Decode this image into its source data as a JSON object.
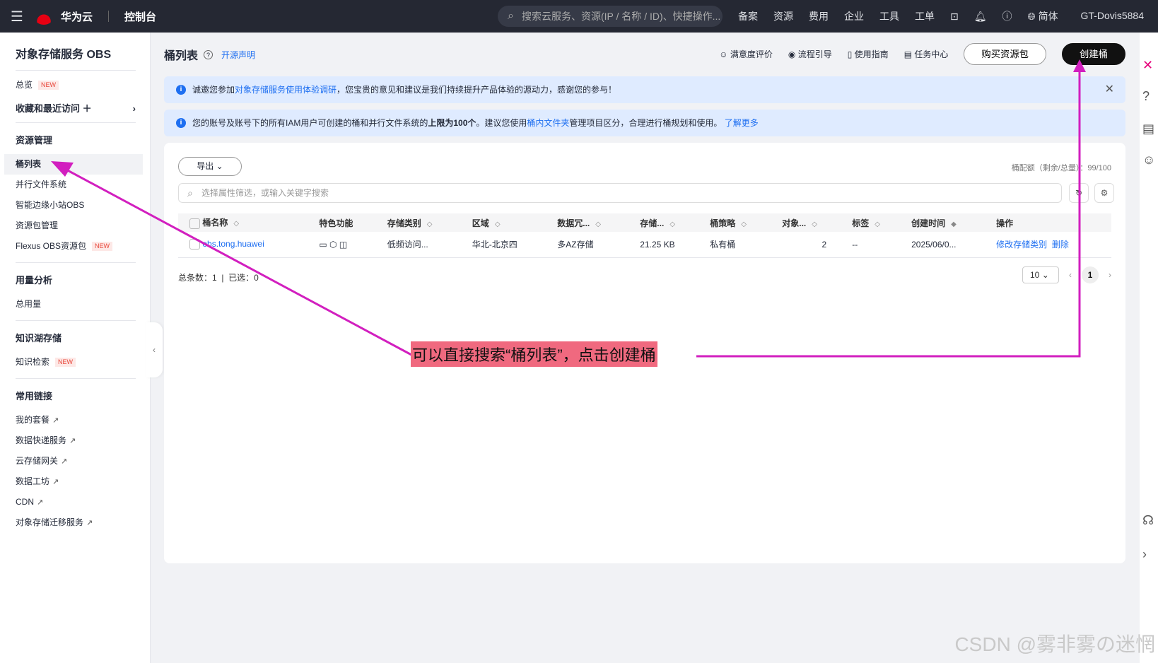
{
  "topbar": {
    "brand": "华为云",
    "brand_sub": "HUAWEI",
    "console": "控制台",
    "search_placeholder": "搜索云服务、资源(IP / 名称 / ID)、快捷操作...",
    "nav": [
      "备案",
      "资源",
      "费用",
      "企业",
      "工具",
      "工单"
    ],
    "lang": "简体",
    "user": "GT-Dovis5884"
  },
  "sidebar": {
    "title": "对象存储服务 OBS",
    "overview": "总览",
    "new": "NEW",
    "favorites": "收藏和最近访问",
    "sections": [
      {
        "title": "资源管理",
        "items": [
          {
            "label": "桶列表",
            "active": true
          },
          {
            "label": "并行文件系统"
          },
          {
            "label": "智能边缘小站OBS"
          },
          {
            "label": "资源包管理"
          },
          {
            "label": "Flexus OBS资源包",
            "new": true
          }
        ]
      },
      {
        "title": "用量分析",
        "items": [
          {
            "label": "总用量"
          }
        ]
      },
      {
        "title": "知识湖存储",
        "items": [
          {
            "label": "知识检索",
            "new": true
          }
        ]
      },
      {
        "title": "常用链接",
        "items": [
          {
            "label": "我的套餐",
            "ext": true
          },
          {
            "label": "数据快递服务",
            "ext": true
          },
          {
            "label": "云存储网关",
            "ext": true
          },
          {
            "label": "数据工坊",
            "ext": true
          },
          {
            "label": "CDN",
            "ext": true
          },
          {
            "label": "对象存储迁移服务",
            "ext": true
          }
        ]
      }
    ]
  },
  "page": {
    "title": "桶列表",
    "open_source": "开源声明",
    "actions": [
      "满意度评价",
      "流程引导",
      "使用指南",
      "任务中心"
    ],
    "buy": "购买资源包",
    "create": "创建桶"
  },
  "banner1": {
    "pre": "诚邀您参加",
    "link": "对象存储服务使用体验调研",
    "post": "，您宝贵的意见和建议是我们持续提升产品体验的源动力，感谢您的参与！"
  },
  "banner2": {
    "pre": "您的账号及账号下的所有IAM用户可创建的桶和并行文件系统的",
    "bold": "上限为100个",
    "mid": "。建议您使用",
    "link": "桶内文件夹",
    "post": "管理项目区分，合理进行桶规划和使用。",
    "more": "了解更多"
  },
  "toolbar": {
    "export": "导出",
    "quota": "桶配额（剩余/总量）：99/100",
    "filter_placeholder": "选择属性筛选，或输入关键字搜索"
  },
  "table": {
    "headers": [
      "桶名称",
      "特色功能",
      "存储类别",
      "区域",
      "数据冗...",
      "存储...",
      "桶策略",
      "对象...",
      "标签",
      "创建时间",
      "操作"
    ],
    "rows": [
      {
        "name": "obs.tong.huawei",
        "class": "低频访问...",
        "region": "华北-北京四",
        "redundancy": "多AZ存储",
        "size": "21.25 KB",
        "policy": "私有桶",
        "objects": "2",
        "tags": "--",
        "created": "2025/06/0...",
        "op1": "修改存储类别",
        "op2": "删除"
      }
    ]
  },
  "footer": {
    "total_label": "总条数：",
    "total": "1",
    "selected_label": "已选：",
    "selected": "0",
    "page_size": "10",
    "page": "1"
  },
  "annotation": "可以直接搜索“桶列表”，点击创建桶",
  "watermark": "CSDN @雾非雾の迷惘"
}
